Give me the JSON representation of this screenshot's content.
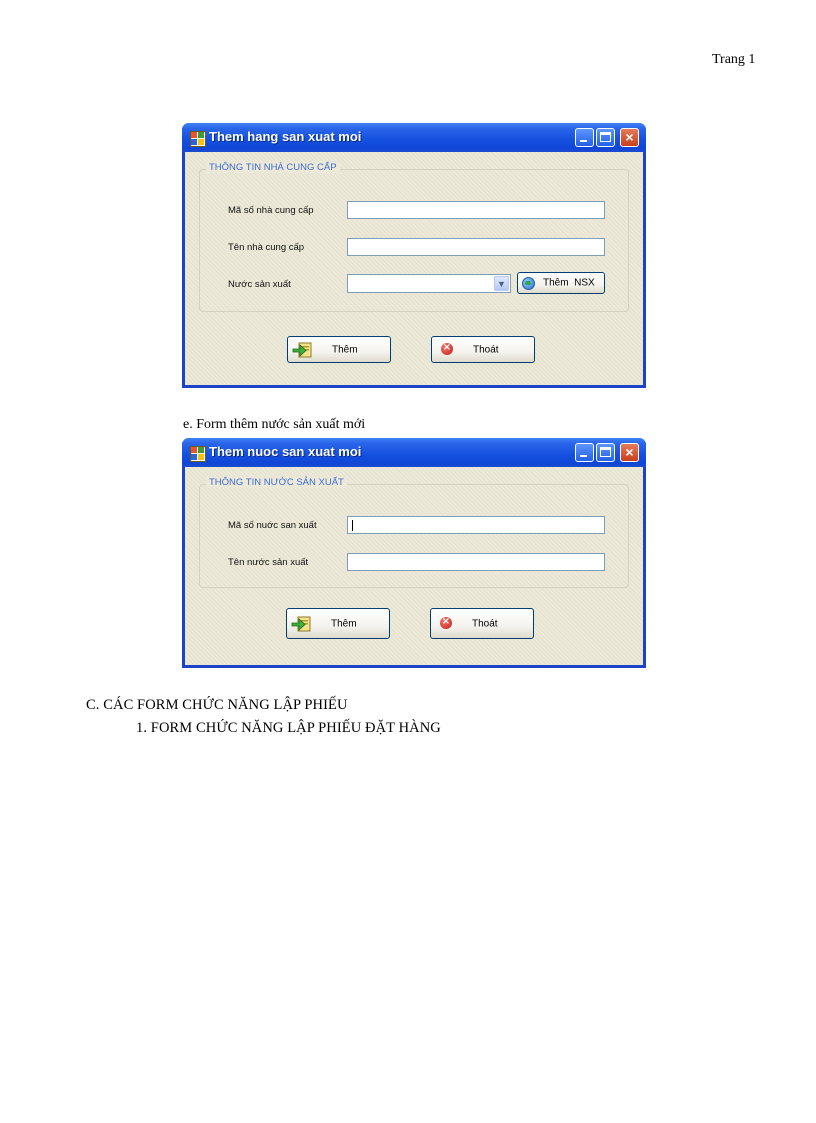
{
  "page": {
    "number_label": "Trang 1"
  },
  "form1": {
    "title": "Them hang san xuat moi",
    "group_title": "THÔNG TIN NHÀ CUNG CẤP",
    "fields": [
      {
        "label": "Mã số nhà cung cấp",
        "value": ""
      },
      {
        "label": "Tên nhà cung cấp",
        "value": ""
      },
      {
        "label": "Nước sản xuất",
        "value": ""
      }
    ],
    "side_button": "Thêm  NSX",
    "add_button": "Thêm",
    "exit_button": "Thoát"
  },
  "caption_e": "e. Form thêm nước sản xuất mới",
  "form2": {
    "title": "Them nuoc san xuat moi",
    "group_title": "THÔNG TIN NƯỚC SẢN XUẤT",
    "fields": [
      {
        "label": "Mã số nuớc san xuất",
        "value": ""
      },
      {
        "label": "Tên nước sản xuất",
        "value": ""
      }
    ],
    "add_button": "Thêm",
    "exit_button": "Thoát"
  },
  "section_c": "C. CÁC FORM CHỨC NĂNG LẬP PHIẾU",
  "section_c1": "1. FORM CHỨC NĂNG LẬP PHIẾU ĐẶT HÀNG",
  "colors": {
    "title_bar": "#1552df",
    "client": "#ece9d8",
    "group_title": "#3d6cd1"
  },
  "icons": {
    "window": "app-icon",
    "add": "arrow-into-box-icon",
    "exit": "red-x-circle-icon",
    "nsx": "globe-icon"
  }
}
